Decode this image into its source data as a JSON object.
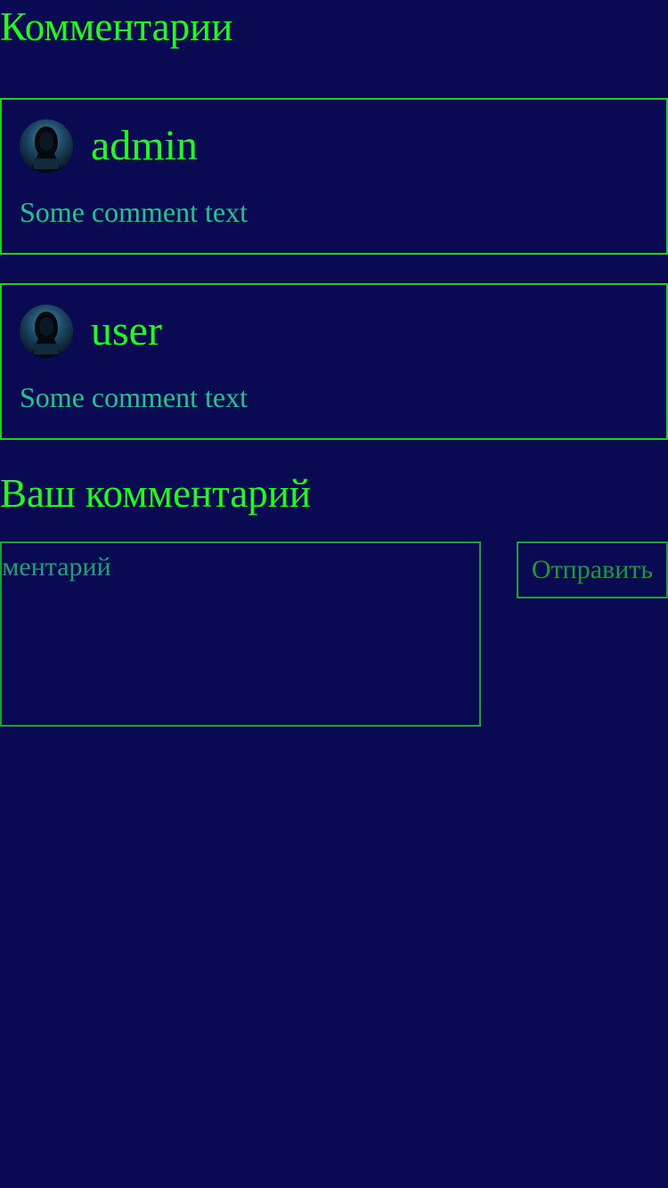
{
  "page": {
    "title": "Комментарии"
  },
  "comments": [
    {
      "author": "admin",
      "text": "Some comment text",
      "avatar_icon": "hooded-hacker-avatar"
    },
    {
      "author": "user",
      "text": "Some comment text",
      "avatar_icon": "hooded-hacker-avatar"
    }
  ],
  "form": {
    "title": "Ваш комментарий",
    "input_placeholder": "Ваш комментарий",
    "input_value": "",
    "submit_label": "Отправить"
  },
  "colors": {
    "background": "#0a0a52",
    "heading": "#19ff19",
    "comment_text": "#1cc78f",
    "card_border": "#19d21e",
    "form_border": "#17a33a"
  }
}
